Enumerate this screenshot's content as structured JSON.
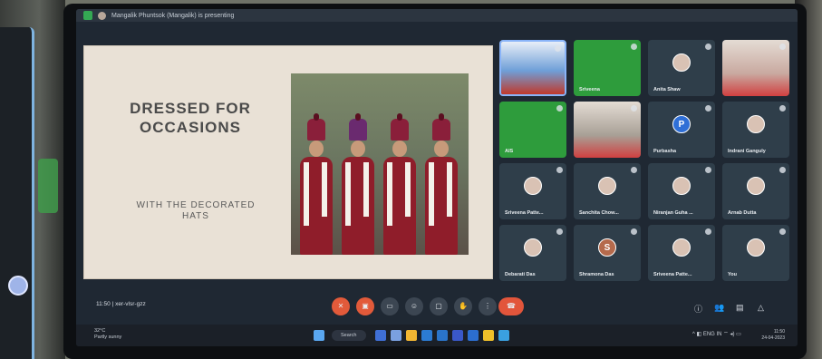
{
  "meet": {
    "presenter_banner": "Mangalik Phuntsok (Mangalik) is presenting",
    "meeting_time": "11:50",
    "meeting_code": "xer-vlsr-gzz"
  },
  "slide": {
    "title": "DRESSED FOR OCCASIONS",
    "subtitle": "WITH THE DECORATED HATS"
  },
  "participants": [
    {
      "name": "",
      "kind": "screen",
      "color": "#6f9fd8"
    },
    {
      "name": "Sriveena",
      "kind": "green",
      "color": "#2e9c3c"
    },
    {
      "name": "Anita Shaw",
      "kind": "avatar",
      "color": "#2f3e4a"
    },
    {
      "name": "",
      "kind": "photo",
      "color": "#c9a9a0"
    },
    {
      "name": "AIS",
      "kind": "green",
      "color": "#2e9c3c"
    },
    {
      "name": "",
      "kind": "photo",
      "color": "#a8a096"
    },
    {
      "name": "Purbasha",
      "kind": "letter",
      "letter": "P",
      "color": "#2f3e4a"
    },
    {
      "name": "Indrani Ganguly",
      "kind": "avatar",
      "color": "#2f3e4a"
    },
    {
      "name": "Sriveena Patte...",
      "kind": "avatar",
      "color": "#2f3e4a"
    },
    {
      "name": "Sanchita Chow...",
      "kind": "avatar",
      "color": "#2f3e4a"
    },
    {
      "name": "Niranjan Guha ...",
      "kind": "avatar",
      "color": "#2f3e4a"
    },
    {
      "name": "Arnab Dutta",
      "kind": "avatar",
      "color": "#2f3e4a"
    },
    {
      "name": "Debarati Das",
      "kind": "avatar",
      "color": "#2f3e4a"
    },
    {
      "name": "Shramona Das",
      "kind": "letter",
      "letter": "S",
      "color": "#2f3e4a"
    },
    {
      "name": "Sriveena Patte...",
      "kind": "avatar",
      "color": "#2f3e4a"
    },
    {
      "name": "You",
      "kind": "avatar",
      "color": "#2f3e4a"
    }
  ],
  "controls": {
    "mic_icon": "mic-off-icon",
    "camera_icon": "camera-off-icon",
    "captions_icon": "captions-icon",
    "emoji_icon": "emoji-icon",
    "present_icon": "present-icon",
    "hand_icon": "raise-hand-icon",
    "more_icon": "more-icon",
    "end_call_icon": "end-call-icon"
  },
  "taskbar": {
    "weather_temp": "32°C",
    "weather_desc": "Partly sunny",
    "search_label": "Search",
    "lang": "ENG IN",
    "clock_time": "11:50",
    "clock_date": "24-04-2023"
  }
}
